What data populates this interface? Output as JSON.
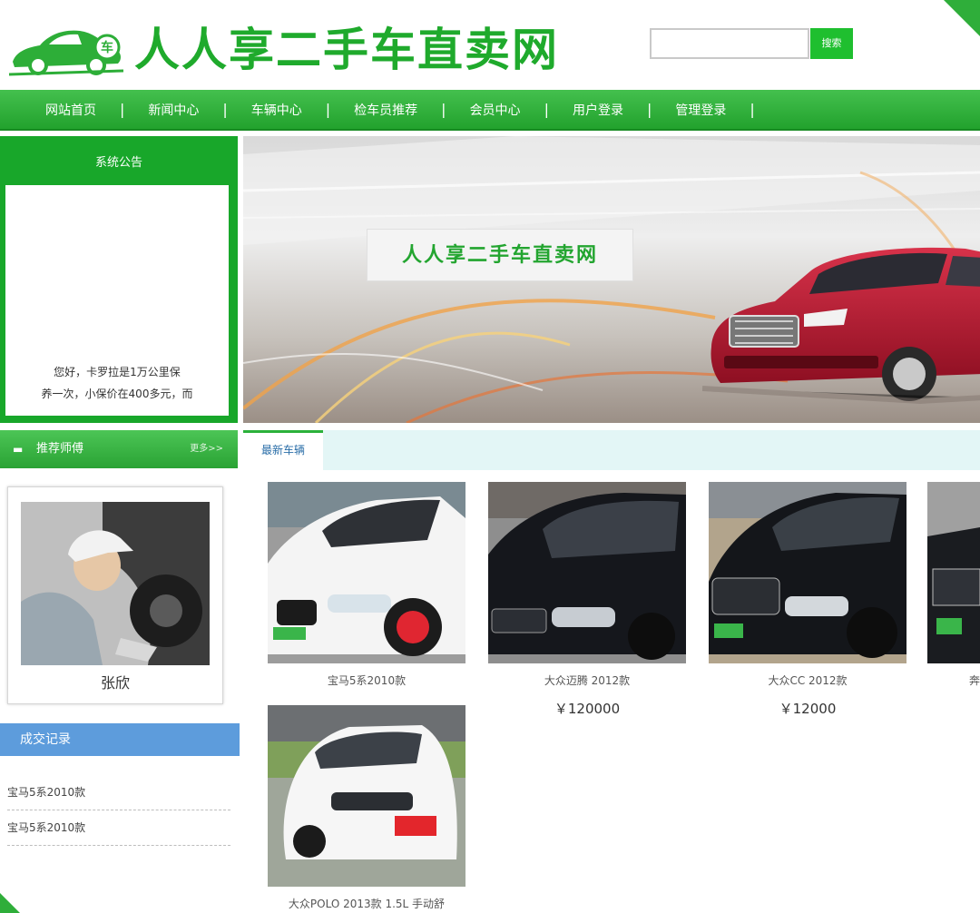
{
  "site": {
    "title": "人人享二手车直卖网",
    "logo_badge": "车"
  },
  "search": {
    "placeholder": "",
    "button_label": "搜索"
  },
  "nav": {
    "items": [
      "网站首页",
      "新闻中心",
      "车辆中心",
      "检车员推荐",
      "会员中心",
      "用户登录",
      "管理登录"
    ],
    "separator": "|"
  },
  "notice": {
    "title": "系统公告",
    "text_line1": "您好，卡罗拉是1万公里保",
    "text_line2": "养一次，小保价在400多元，而"
  },
  "banner": {
    "title": "人人享二手车直卖网"
  },
  "technician": {
    "section_title": "推荐师傅",
    "more_label": "更多>>",
    "name": "张欣"
  },
  "records": {
    "title": "成交记录",
    "items": [
      "宝马5系2010款",
      "宝马5系2010款"
    ]
  },
  "vehicles": {
    "tab_label": "最新车辆",
    "items": [
      {
        "name": "宝马5系2010款",
        "price": ""
      },
      {
        "name": "大众迈腾 2012款",
        "price": "￥120000"
      },
      {
        "name": "大众CC 2012款",
        "price": "￥12000"
      },
      {
        "name": "奔",
        "price": ""
      },
      {
        "name": "大众POLO 2013款 1.5L 手动舒",
        "price": ""
      }
    ]
  },
  "colors": {
    "brand_green": "#1faa2c",
    "nav_green": "#2aa334",
    "records_blue": "#5d9cdc"
  }
}
